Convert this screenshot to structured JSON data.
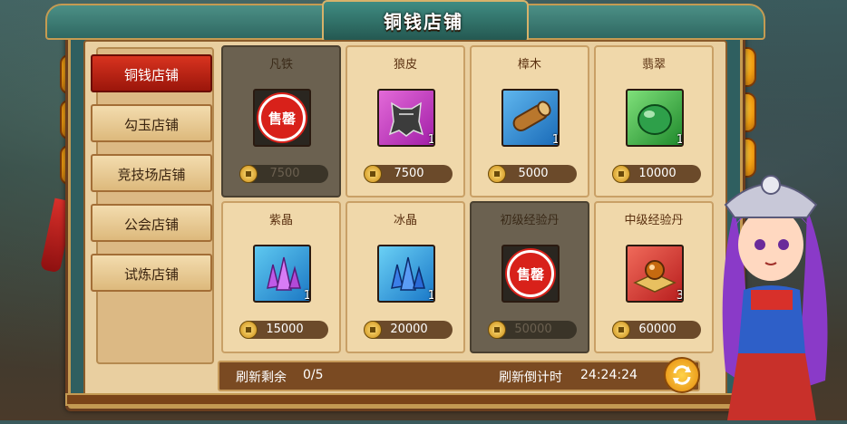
{
  "title": "铜钱店铺",
  "sidebar": {
    "items": [
      {
        "label": "铜钱店铺",
        "active": true
      },
      {
        "label": "勾玉店铺",
        "active": false
      },
      {
        "label": "竞技场店铺",
        "active": false
      },
      {
        "label": "公会店铺",
        "active": false
      },
      {
        "label": "试炼店铺",
        "active": false
      }
    ]
  },
  "shop": {
    "sold_stamp": "售罄",
    "items": [
      {
        "name": "凡铁",
        "price": "7500",
        "qty": "",
        "sold": true,
        "icon": "sold-stamp-icon"
      },
      {
        "name": "狼皮",
        "price": "7500",
        "qty": "1",
        "sold": false,
        "icon": "wolf-pelt-icon"
      },
      {
        "name": "樟木",
        "price": "5000",
        "qty": "1",
        "sold": false,
        "icon": "wood-log-icon"
      },
      {
        "name": "翡翠",
        "price": "10000",
        "qty": "1",
        "sold": false,
        "icon": "jade-icon"
      },
      {
        "name": "紫晶",
        "price": "15000",
        "qty": "1",
        "sold": false,
        "icon": "purple-crystal-icon"
      },
      {
        "name": "冰晶",
        "price": "20000",
        "qty": "1",
        "sold": false,
        "icon": "ice-crystal-icon"
      },
      {
        "name": "初级经验丹",
        "price": "50000",
        "qty": "",
        "sold": true,
        "icon": "sold-stamp-icon"
      },
      {
        "name": "中级经验丹",
        "price": "60000",
        "qty": "3",
        "sold": false,
        "icon": "exp-pill-icon"
      }
    ]
  },
  "footer": {
    "refresh_remaining_label": "刷新剩余",
    "refresh_remaining_value": "0/5",
    "countdown_label": "刷新倒计时",
    "countdown_value": "24:24:24"
  },
  "colors": {
    "active_tab": "#d8331f",
    "panel": "#e9cfa0",
    "frame": "#2f5f60"
  }
}
